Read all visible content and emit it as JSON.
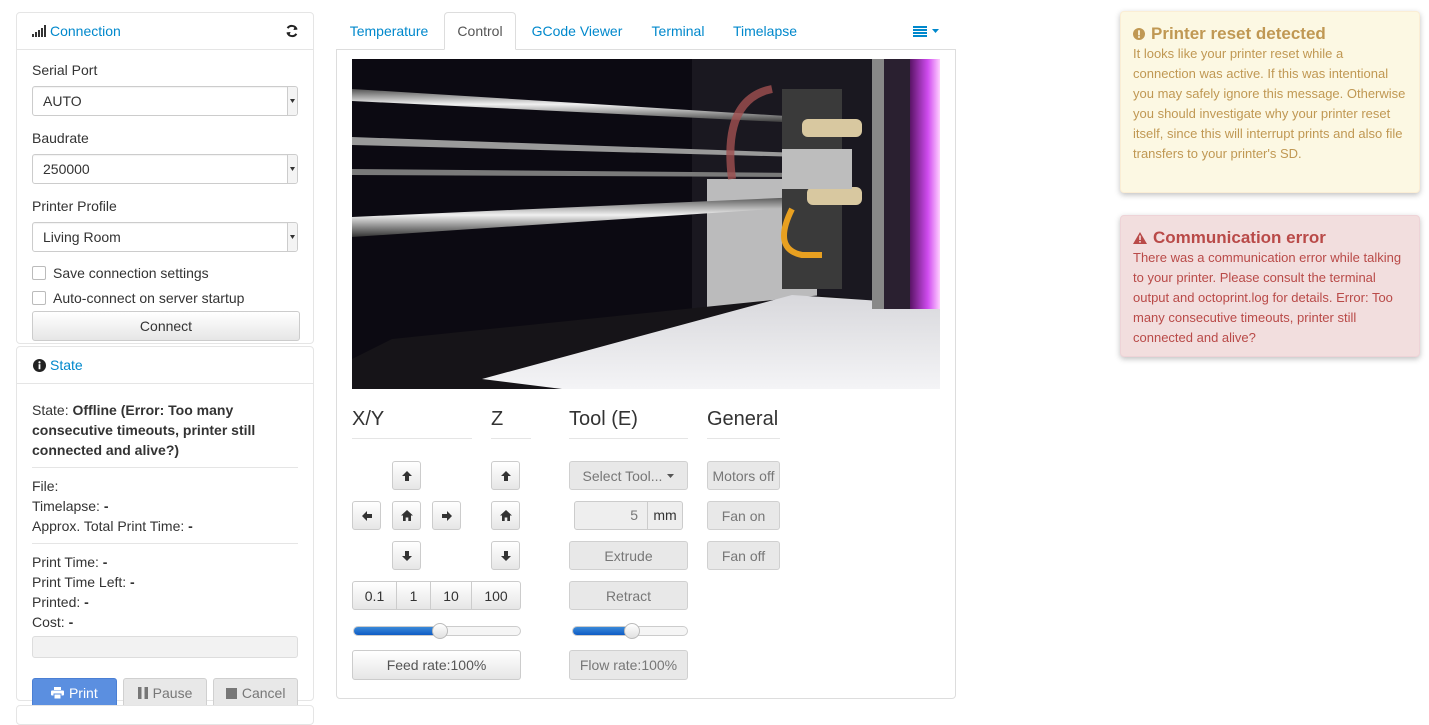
{
  "connection": {
    "title": "Connection",
    "serial_port_label": "Serial Port",
    "serial_port_value": "AUTO",
    "baudrate_label": "Baudrate",
    "baudrate_value": "250000",
    "profile_label": "Printer Profile",
    "profile_value": "Living Room",
    "save_settings_label": "Save connection settings",
    "autoconnect_label": "Auto-connect on server startup",
    "connect_button": "Connect"
  },
  "state": {
    "title": "State",
    "state_label": "State:",
    "state_value": "Offline (Error: Too many consecutive timeouts, printer still connected and alive?)",
    "file_label": "File:",
    "file_value": "",
    "timelapse_label": "Timelapse:",
    "timelapse_value": "-",
    "approx_label": "Approx. Total Print Time:",
    "approx_value": "-",
    "print_time_label": "Print Time:",
    "print_time_value": "-",
    "time_left_label": "Print Time Left:",
    "time_left_value": "-",
    "printed_label": "Printed:",
    "printed_value": "-",
    "cost_label": "Cost:",
    "cost_value": "-",
    "progress": 0,
    "print_button": "Print",
    "pause_button": "Pause",
    "cancel_button": "Cancel"
  },
  "tabs": [
    "Temperature",
    "Control",
    "GCode Viewer",
    "Terminal",
    "Timelapse"
  ],
  "active_tab": "Control",
  "control": {
    "xy_title": "X/Y",
    "z_title": "Z",
    "tool_title": "Tool (E)",
    "general_title": "General",
    "steps": [
      "0.1",
      "1",
      "10",
      "100"
    ],
    "select_tool": "Select Tool...",
    "extrude_amount": "5",
    "extrude_unit": "mm",
    "extrude_button": "Extrude",
    "retract_button": "Retract",
    "feed_rate_button": "Feed rate:100%",
    "flow_rate_button": "Flow rate:100%",
    "feed_rate_value": 100,
    "flow_rate_value": 100,
    "motors_off_button": "Motors off",
    "fan_on_button": "Fan on",
    "fan_off_button": "Fan off"
  },
  "notifications": {
    "reset_title": "Printer reset detected",
    "reset_text": "It looks like your printer reset while a connection was active. If this was intentional you may safely ignore this message. Otherwise you should investigate why your printer reset itself, since this will interrupt prints and also file transfers to your printer's SD.",
    "error_title": "Communication error",
    "error_text": "There was a communication error while talking to your printer. Please consult the terminal output and octoprint.log for details. Error: Too many consecutive timeouts, printer still connected and alive?"
  },
  "colors": {
    "link": "#0088cc",
    "warn_bg": "#fcf8e3",
    "warn_text": "#c09853",
    "error_bg": "#f2dede",
    "error_text": "#b94a48",
    "primary": "#5b8fe0",
    "slider_fill": "#0e5bc5"
  }
}
